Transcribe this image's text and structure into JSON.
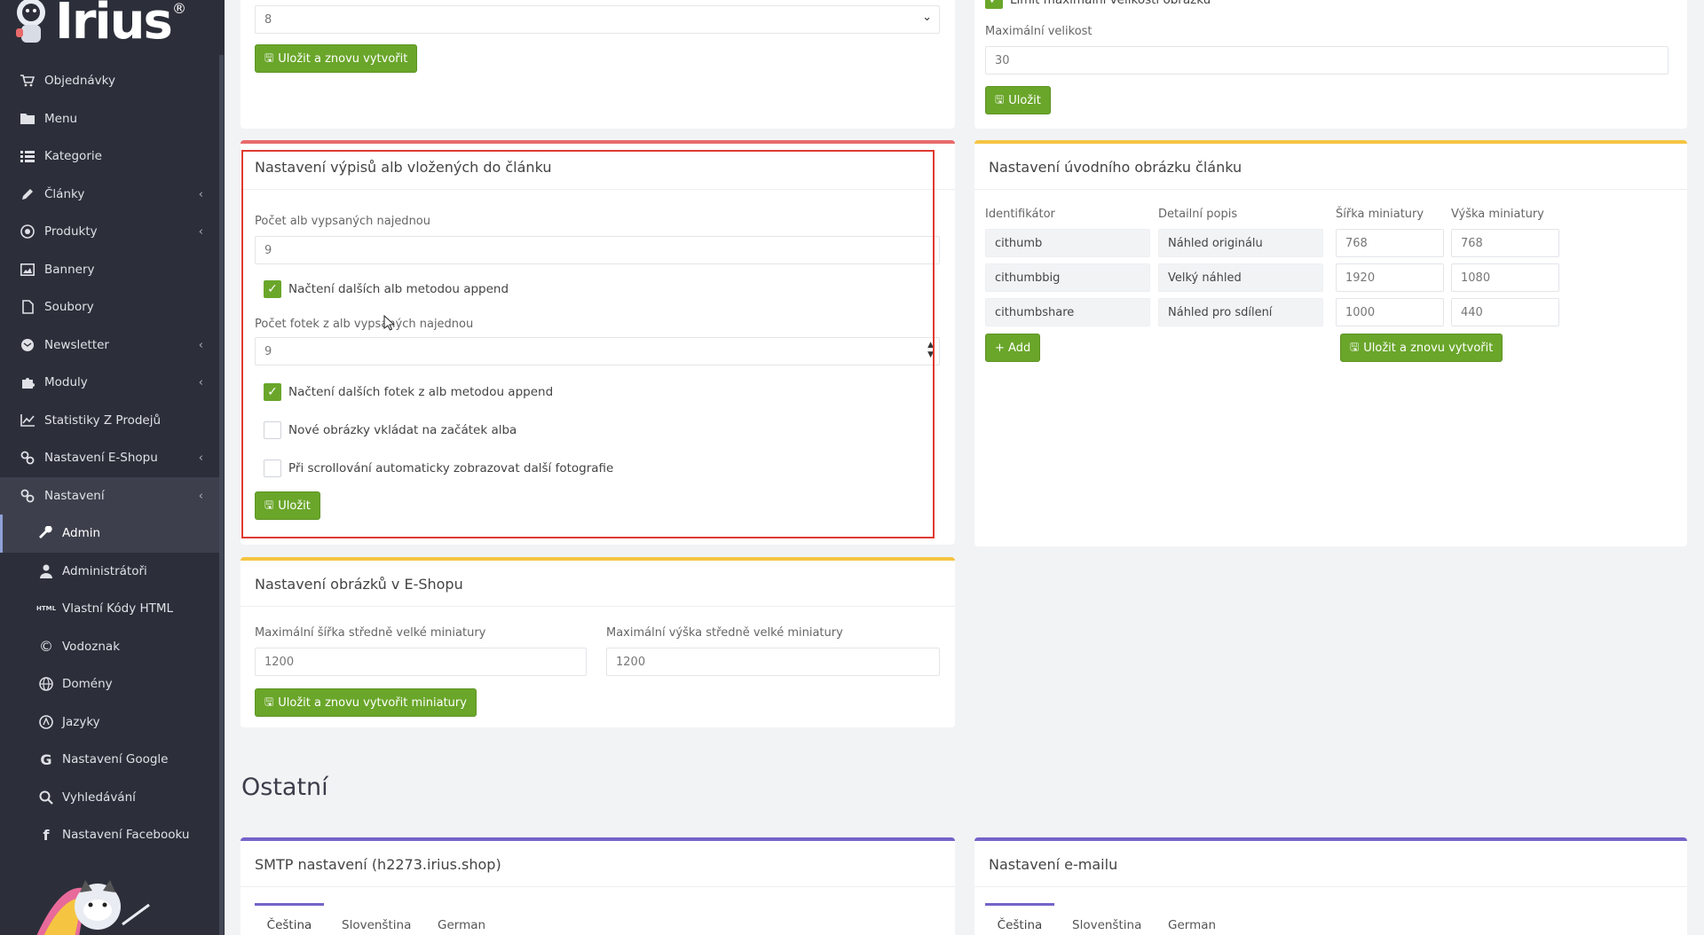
{
  "sidebar": {
    "brand": "Irius",
    "items": [
      {
        "label": "Objednávky",
        "icon": "cart-icon",
        "has_children": false
      },
      {
        "label": "Menu",
        "icon": "folder-icon",
        "has_children": false
      },
      {
        "label": "Kategorie",
        "icon": "list-icon",
        "has_children": false
      },
      {
        "label": "Články",
        "icon": "pencil-icon",
        "has_children": true
      },
      {
        "label": "Produkty",
        "icon": "globe-icon",
        "has_children": true
      },
      {
        "label": "Bannery",
        "icon": "image-icon",
        "has_children": false
      },
      {
        "label": "Soubory",
        "icon": "file-icon",
        "has_children": false
      },
      {
        "label": "Newsletter",
        "icon": "envelope-icon",
        "has_children": true
      },
      {
        "label": "Moduly",
        "icon": "puzzle-icon",
        "has_children": true
      },
      {
        "label": "Statistiky Z Prodejů",
        "icon": "chart-icon",
        "has_children": false
      },
      {
        "label": "Nastavení E-Shopu",
        "icon": "gears-icon",
        "has_children": true
      },
      {
        "label": "Nastavení",
        "icon": "gears-icon",
        "has_children": true
      }
    ],
    "subitems": [
      {
        "label": "Admin",
        "icon": "wrench-icon"
      },
      {
        "label": "Administrátoři",
        "icon": "user-icon"
      },
      {
        "label": "Vlastní Kódy HTML",
        "icon": "html-icon"
      },
      {
        "label": "Vodoznak",
        "icon": "copyright-icon"
      },
      {
        "label": "Domény",
        "icon": "globe-icon"
      },
      {
        "label": "Jazyky",
        "icon": "language-icon"
      },
      {
        "label": "Nastavení Google",
        "icon": "google-icon"
      },
      {
        "label": "Vyhledávání",
        "icon": "search-icon"
      },
      {
        "label": "Nastavení Facebooku",
        "icon": "facebook-icon"
      }
    ]
  },
  "top_left_card": {
    "select_value": "8",
    "button": "Uložit a znovu vytvořit"
  },
  "top_right_card": {
    "checkbox_label": "Limit maximální velikosti obrázku",
    "max_size_label": "Maximální velikost",
    "max_size_value": "30",
    "button": "Uložit"
  },
  "albums_card": {
    "title": "Nastavení výpisů alb vložených do článku",
    "count_label": "Počet alb vypsaných najednou",
    "count_value": "9",
    "append_label": "Načtení dalších alb metodou append",
    "photos_label": "Počet fotek z alb vypsaných najednou",
    "photos_value": "9",
    "photos_append_label": "Načtení dalších fotek z alb metodou append",
    "new_images_label": "Nové obrázky vkládat na začátek alba",
    "scroll_label": "Při scrollování automaticky zobrazovat další fotografie",
    "button": "Uložit"
  },
  "thumb_card": {
    "title": "Nastavení úvodního obrázku článku",
    "headers": [
      "Identifikátor",
      "Detailní popis",
      "Šířka miniatury",
      "Výška miniatury"
    ],
    "rows": [
      [
        "cithumb",
        "Náhled originálu",
        "768",
        "768"
      ],
      [
        "cithumbbig",
        "Velký náhled",
        "1920",
        "1080"
      ],
      [
        "cithumbshare",
        "Náhled pro sdílení",
        "1000",
        "440"
      ]
    ],
    "add_button": "+ Add",
    "save_button": "Uložit a znovu vytvořit"
  },
  "eshop_images_card": {
    "title": "Nastavení obrázků v E-Shopu",
    "width_label": "Maximální šířka středně velké miniatury",
    "width_value": "1200",
    "height_label": "Maximální výška středně velké miniatury",
    "height_value": "1200",
    "button": "Uložit a znovu vytvořit miniatury"
  },
  "section": {
    "title": "Ostatní"
  },
  "smtp_card": {
    "title": "SMTP nastavení (h2273.irius.shop)",
    "tabs": [
      "Čeština",
      "Slovenština",
      "German"
    ]
  },
  "email_card": {
    "title": "Nastavení e-mailu",
    "tabs": [
      "Čeština",
      "Slovenština",
      "German"
    ]
  },
  "colors": {
    "accent_green": "#6aa62a",
    "highlight_red": "#e03a31",
    "sidebar_bg": "#2c2f3a"
  }
}
